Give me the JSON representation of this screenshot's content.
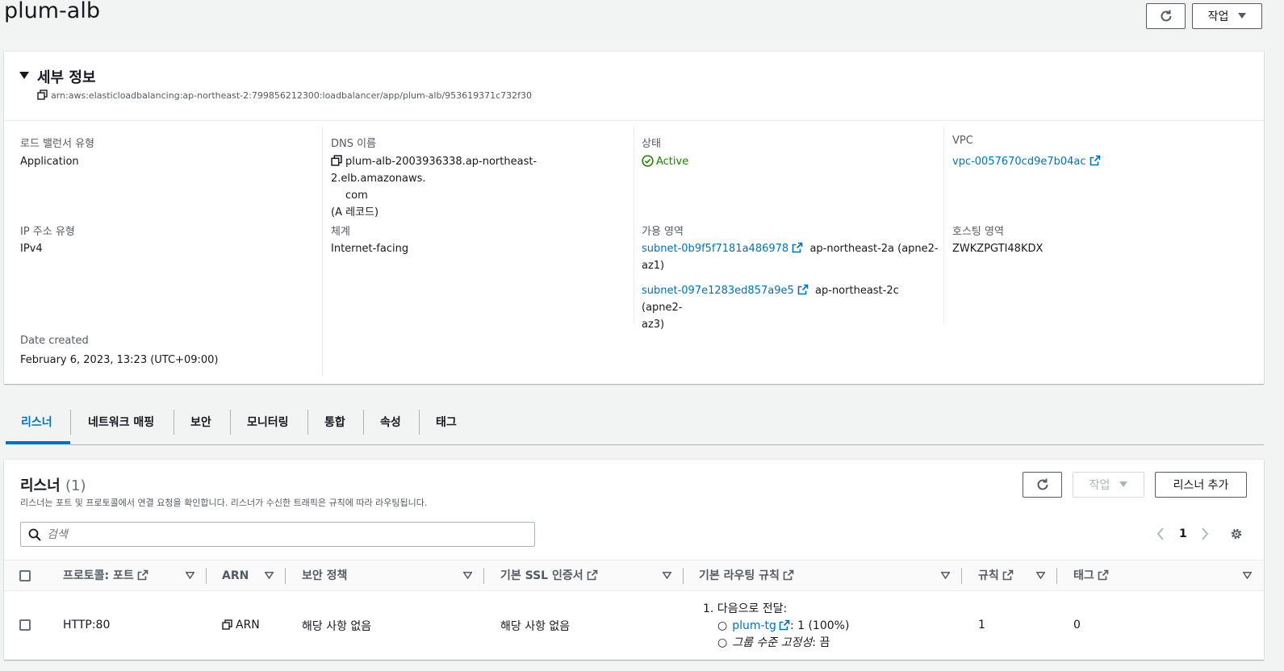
{
  "header": {
    "title": "plum-alb",
    "actions_label": "작업"
  },
  "details": {
    "section_title": "세부 정보",
    "arn": "arn:aws:elasticloadbalancing:ap-northeast-2:799856212300:loadbalancer/app/plum-alb/953619371c732f30",
    "lb_type_label": "로드 밸런서 유형",
    "lb_type_value": "Application",
    "dns_label": "DNS 이름",
    "dns_line1": "plum-alb-2003936338.ap-northeast-2.elb.amazonaws.",
    "dns_line2": "com",
    "dns_line3": "(A 레코드)",
    "state_label": "상태",
    "state_value": "Active",
    "vpc_label": "VPC",
    "vpc_value": "vpc-0057670cd9e7b04ac",
    "ip_type_label": "IP 주소 유형",
    "ip_type_value": "IPv4",
    "scheme_label": "체계",
    "scheme_value": "Internet-facing",
    "az_label": "가용 영역",
    "az1_subnet": "subnet-0b9f5f7181a486978",
    "az1_zone_line1": "ap-northeast-2a (apne2-",
    "az1_zone_line2": "az1)",
    "az2_subnet": "subnet-097e1283ed857a9e5",
    "az2_zone_line1": "ap-northeast-2c (apne2-",
    "az2_zone_line2": "az3)",
    "hosted_zone_label": "호스팅 영역",
    "hosted_zone_value": "ZWKZPGTI48KDX",
    "date_label": "Date created",
    "date_value": "February 6, 2023, 13:23 (UTC+09:00)"
  },
  "tabs": [
    "리스너",
    "네트워크 매핑",
    "보안",
    "모니터링",
    "통합",
    "속성",
    "태그"
  ],
  "active_tab": "리스너",
  "listeners": {
    "title": "리스너",
    "count": "(1)",
    "description": "리스너는 포트 및 프로토콜에서 연결 요청을 확인합니다. 리스너가 수신한 트래픽은 규칙에 따라 라우팅됩니다.",
    "actions_label": "작업",
    "add_label": "리스너 추가",
    "search_placeholder": "검색",
    "page": "1",
    "columns": {
      "protocol_port": "프로토콜: 포트",
      "arn": "ARN",
      "security_policy": "보안 정책",
      "ssl_cert": "기본 SSL 인증서",
      "routing": "기본 라우팅 규칙",
      "rules": "규칙",
      "tags": "태그"
    },
    "rows": [
      {
        "protocol_port": "HTTP:80",
        "arn": "ARN",
        "security_policy": "해당 사항 없음",
        "ssl_cert": "해당 사항 없음",
        "routing_head": "1. 다음으로 전달:",
        "routing_tg": "plum-tg",
        "routing_tg_weight": ": 1 (100%)",
        "routing_stickiness_label": "그룹 수준 고정성",
        "routing_stickiness_value": ": 끔",
        "rules": "1",
        "tags": "0"
      }
    ]
  },
  "colors": {
    "link": "#0073bb",
    "success": "#1d8102",
    "tab_active": "#0073bb"
  }
}
